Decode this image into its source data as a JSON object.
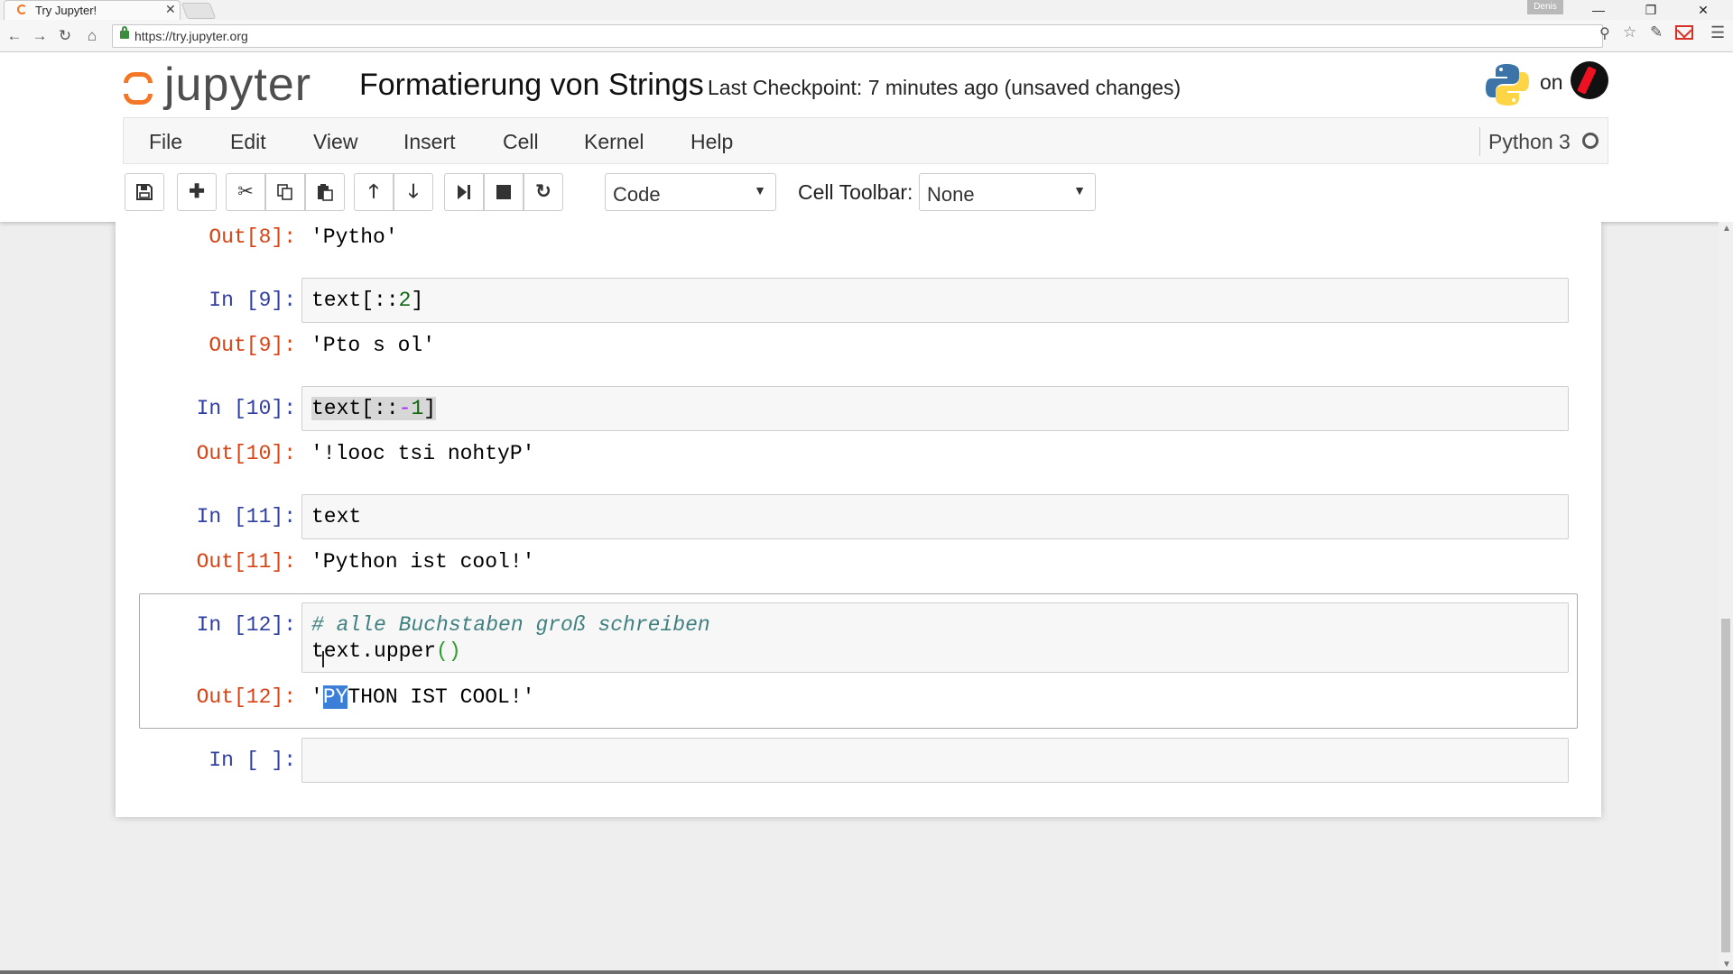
{
  "browser": {
    "tab_title": "Try Jupyter!",
    "tab_close": "✕",
    "user_badge": "Denis",
    "window_controls": {
      "minimize": "—",
      "maximize": "❐",
      "close": "✕"
    },
    "nav": {
      "back": "←",
      "forward": "→",
      "reload": "↻",
      "home": "⌂"
    },
    "url": "https://try.jupyter.org",
    "icons": [
      "zoom-icon",
      "star-icon",
      "extension-icon",
      "gmail-icon",
      "menu-icon"
    ]
  },
  "header": {
    "logo_text": "jupyter",
    "notebook_title": "Formatierung von Strings",
    "checkpoint": "Last Checkpoint: 7 minutes ago (unsaved changes)",
    "on_text": "on"
  },
  "menubar": {
    "items": [
      "File",
      "Edit",
      "View",
      "Insert",
      "Cell",
      "Kernel",
      "Help"
    ],
    "kernel_name": "Python 3"
  },
  "toolbar": {
    "icons": [
      "save-icon",
      "plus-icon",
      "cut-icon",
      "copy-icon",
      "paste-icon",
      "arrow-up-icon",
      "arrow-down-icon",
      "run-icon",
      "stop-icon",
      "restart-icon"
    ],
    "cell_type": "Code",
    "cell_toolbar_label": "Cell Toolbar:",
    "cell_toolbar_value": "None"
  },
  "cells": [
    {
      "out_prompt": "Out[8]:",
      "output": "'Pytho'"
    },
    {
      "in_prompt": "In [9]:",
      "code": {
        "pre": "text[::",
        "num": "2",
        "post": "]"
      },
      "out_prompt": "Out[9]:",
      "output": "'Pto s ol'"
    },
    {
      "in_prompt": "In [10]:",
      "code": {
        "pre": "text[::",
        "op": "-",
        "num": "1",
        "post": "]"
      },
      "out_prompt": "Out[10]:",
      "output": "'!looc tsi nohtyP'"
    },
    {
      "in_prompt": "In [11]:",
      "code": {
        "line": "text"
      },
      "out_prompt": "Out[11]:",
      "output": "'Python ist cool!'"
    },
    {
      "in_prompt": "In [12]:",
      "code": {
        "comment": "# alle Buchstaben groß schreiben",
        "line": "text.upper",
        "paren": "()"
      },
      "out_prompt": "Out[12]:",
      "output": {
        "pre": "'",
        "selected": "PY",
        "post": "THON IST COOL!'"
      }
    },
    {
      "in_prompt": "In [ ]:"
    }
  ],
  "colors": {
    "in_prompt": "#303f9f",
    "out_prompt": "#d84315",
    "jupyter_orange": "#f37726"
  }
}
